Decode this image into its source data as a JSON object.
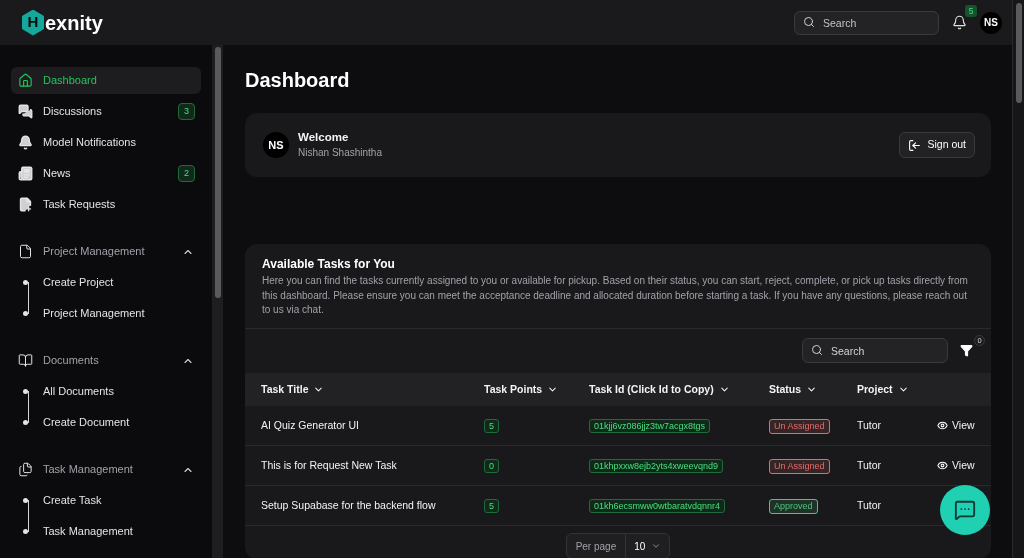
{
  "header": {
    "logo": {
      "mark": "H",
      "text": "exnity"
    },
    "search": {
      "placeholder": "Search"
    },
    "notifications": {
      "count": "5"
    },
    "avatar": {
      "initials": "NS"
    }
  },
  "sidebar": {
    "items": [
      {
        "label": "Dashboard",
        "selected": true
      },
      {
        "label": "Discussions",
        "selected": false,
        "badge": "3"
      },
      {
        "label": "Model Notifications",
        "selected": false
      },
      {
        "label": "News",
        "selected": false,
        "badge": "2"
      },
      {
        "label": "Task Requests",
        "selected": false
      }
    ],
    "groups": [
      {
        "label": "Project Management",
        "expanded": true,
        "children": [
          {
            "label": "Create Project",
            "selected": false
          },
          {
            "label": "Project Management",
            "selected": false
          }
        ]
      },
      {
        "label": "Documents",
        "expanded": true,
        "children": [
          {
            "label": "All Documents",
            "selected": false
          },
          {
            "label": "Create Document",
            "selected": false
          }
        ]
      },
      {
        "label": "Task Management",
        "expanded": true,
        "children": [
          {
            "label": "Create Task",
            "selected": false
          },
          {
            "label": "Task Management",
            "selected": false
          }
        ]
      }
    ]
  },
  "main": {
    "title": "Dashboard",
    "welcome": {
      "avatar": "NS",
      "title": "Welcome",
      "name": "Nishan Shashintha",
      "button": "Sign out"
    },
    "tasks": {
      "title": "Available Tasks for You",
      "description": "Here you can find the tasks currently assigned to you or available for pickup. Based on their status, you can start, reject, complete, or pick up tasks directly from this dashboard. Please ensure you can meet the acceptance deadline and allocated duration before starting a task. If you have any questions, please reach out to us via chat.",
      "search": {
        "placeholder": "Search"
      },
      "filter_count": "0",
      "table": {
        "columns": [
          "Task Title",
          "Task Points",
          "Task Id (Click Id to Copy)",
          "Status",
          "Project"
        ],
        "rows": [
          {
            "title": "AI Quiz Generator UI",
            "points": "5",
            "task_id": "01kjj6vz086jjz3tw7acgx8tgs",
            "status": {
              "label": "Un Assigned",
              "color": "#e06c6c"
            },
            "project": "Tutor",
            "action": "View"
          },
          {
            "title": "This is for Request New Task",
            "points": "0",
            "task_id": "01khpxxw8ejb2yts4xweevqnd9",
            "status": {
              "label": "Un Assigned",
              "color": "#e06c6c"
            },
            "project": "Tutor",
            "action": "View"
          },
          {
            "title": "Setup Supabase for the backend flow",
            "points": "5",
            "task_id": "01kh6ecsmww0wtbaratvdqnnr4",
            "status": {
              "label": "Approved",
              "color": "#4cc47a"
            },
            "project": "Tutor"
          }
        ]
      },
      "pagination": {
        "label": "Per page",
        "value": "10"
      }
    }
  }
}
